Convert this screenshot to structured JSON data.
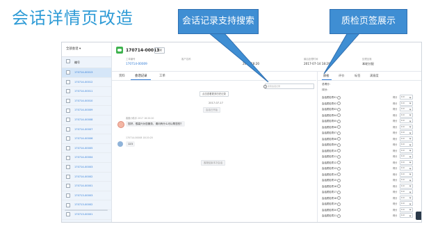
{
  "slide_title": "会话详情页改造",
  "callouts": {
    "left": "会话记录支持搜索",
    "right": "质检页签展示"
  },
  "sidebar": {
    "filter_label": "全部会话 ▾",
    "header": "编号",
    "items": [
      "170714-00013",
      "170714-00012",
      "170714-00011",
      "170714-00010",
      "170714-00009",
      "170714-00008",
      "170714-00007",
      "170714-00006",
      "170714-00005",
      "170714-00004",
      "170714-00003",
      "170714-00002",
      "170714-00001",
      "170713-00003",
      "170713-00002",
      "170713-00001"
    ]
  },
  "header": {
    "conversation_id": "170714-00013",
    "action_button": "发起",
    "fields": [
      {
        "label": "工单编号",
        "value": "170714-00009"
      },
      {
        "label": "客户名称",
        "value": ""
      },
      {
        "label": "",
        "value": "2017 18:20"
      },
      {
        "label": "最后处理时间",
        "value": "2017-07-14 18:29"
      },
      {
        "label": "处理坐席",
        "value": "本轮分配"
      }
    ]
  },
  "center": {
    "tabs": [
      "资料",
      "会话记录",
      "工单"
    ],
    "search_placeholder": "搜索会话记录",
    "load_more": "点击查看更多历史记录",
    "date_divider": "2017-07-17",
    "system_notice": "会话已开始",
    "agent_meta": "客服小助手 2017 18:20:20",
    "agent_msg": "您好，很高兴为您服务，请问有什么可以帮您的？",
    "customer_meta": "170714-00008 18:20:20",
    "customer_msg": "123",
    "end_notice": "客服结束本次会话"
  },
  "right_panel": {
    "tabs": [
      "质检",
      "评价",
      "标签",
      "满意度"
    ],
    "total_label": "总得分：",
    "rating_label": "评分：",
    "rows": [
      {
        "name": "会话质检项01",
        "score_label": "得分",
        "value": "0.0"
      },
      {
        "name": "会话质检项02",
        "score_label": "得分",
        "value": "0.0"
      },
      {
        "name": "会话质检项03",
        "score_label": "得分",
        "value": "0.0"
      },
      {
        "name": "会话质检项04",
        "score_label": "得分",
        "value": "0.0"
      },
      {
        "name": "会话质检项05",
        "score_label": "得分",
        "value": "0.0"
      },
      {
        "name": "会话质检项06",
        "score_label": "得分",
        "value": "0.0"
      },
      {
        "name": "会话质检项07",
        "score_label": "得分",
        "value": "0.0"
      },
      {
        "name": "会话质检项08",
        "score_label": "得分",
        "value": "0.0"
      },
      {
        "name": "会话质检项09",
        "score_label": "得分",
        "value": "0.0"
      },
      {
        "name": "会话质检项10",
        "score_label": "得分",
        "value": "0.0"
      },
      {
        "name": "会话质检项11",
        "score_label": "得分",
        "value": "0.0"
      },
      {
        "name": "会话质检项12",
        "score_label": "得分",
        "value": "0.0"
      },
      {
        "name": "会话质检项13",
        "score_label": "得分",
        "value": "0.0"
      },
      {
        "name": "会话质检项14",
        "score_label": "得分",
        "value": "0.0"
      },
      {
        "name": "会话质检项15",
        "score_label": "得分",
        "value": "0.0"
      },
      {
        "name": "会话质检项16",
        "score_label": "得分",
        "value": "0.0"
      },
      {
        "name": "会话质检项17",
        "score_label": "得分",
        "value": "0.0"
      },
      {
        "name": "会话质检项18",
        "score_label": "得分",
        "value": "0.0"
      },
      {
        "name": "会话质检项19",
        "score_label": "得分",
        "value": "0.0"
      },
      {
        "name": "会话质检项20",
        "score_label": "得分",
        "value": "0.0"
      },
      {
        "name": "会话质检项21",
        "score_label": "得分",
        "value": "0.0"
      }
    ]
  },
  "colors": {
    "title": "#2e9bd6",
    "callout": "#3f8ed3",
    "accent": "#2f7bd6",
    "sidebar_bg": "#eef4fb"
  }
}
